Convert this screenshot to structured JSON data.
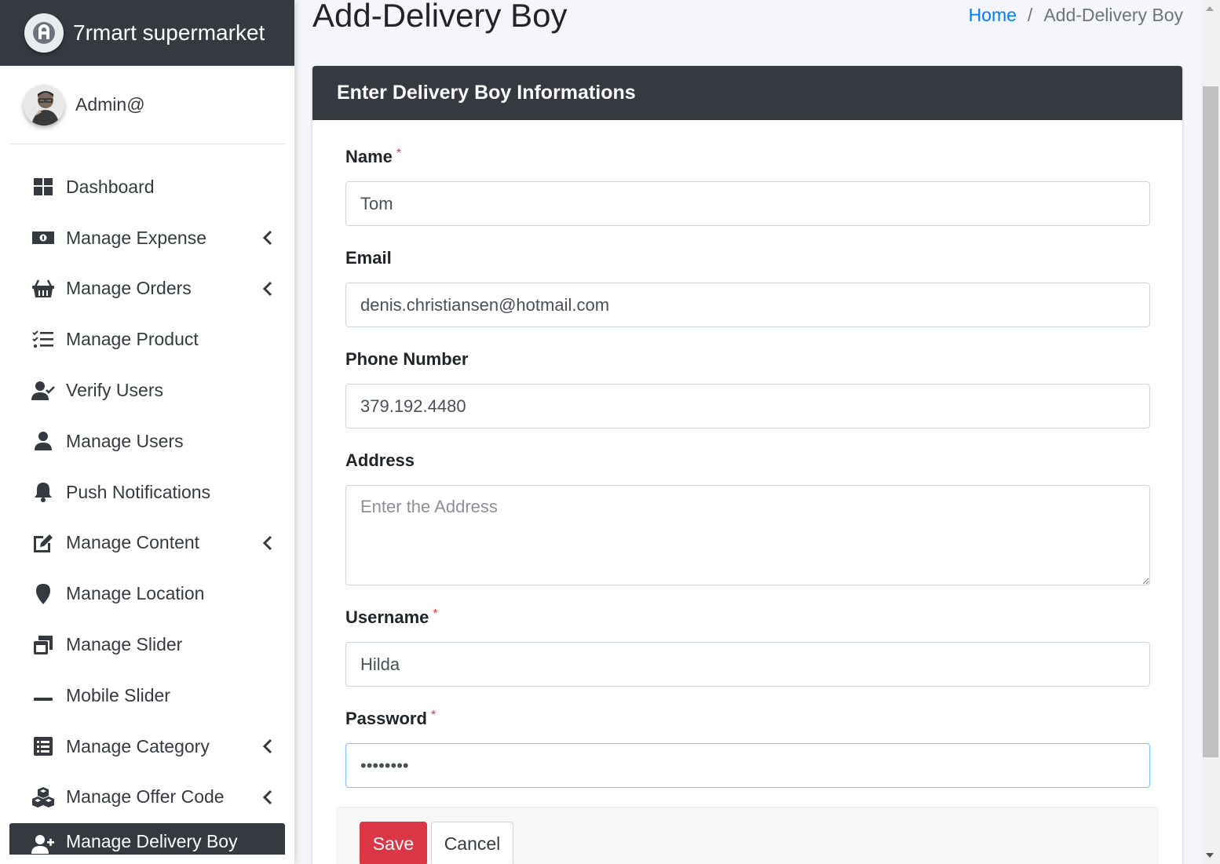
{
  "brand": {
    "name": "7rmart supermarket"
  },
  "user": {
    "name": "Admin@"
  },
  "sidebar": {
    "items": [
      {
        "label": "Dashboard",
        "icon": "dashboard-icon",
        "has_arrow": false
      },
      {
        "label": "Manage Expense",
        "icon": "money-bill-icon",
        "has_arrow": true
      },
      {
        "label": "Manage Orders",
        "icon": "shopping-basket-icon",
        "has_arrow": true
      },
      {
        "label": "Manage Product",
        "icon": "tasks-list-icon",
        "has_arrow": false
      },
      {
        "label": "Verify Users",
        "icon": "user-check-icon",
        "has_arrow": false
      },
      {
        "label": "Manage Users",
        "icon": "user-icon",
        "has_arrow": false
      },
      {
        "label": "Push Notifications",
        "icon": "bell-icon",
        "has_arrow": false
      },
      {
        "label": "Manage Content",
        "icon": "edit-icon",
        "has_arrow": true
      },
      {
        "label": "Manage Location",
        "icon": "map-marker-icon",
        "has_arrow": false
      },
      {
        "label": "Manage Slider",
        "icon": "window-restore-icon",
        "has_arrow": false
      },
      {
        "label": "Mobile Slider",
        "icon": "minus-icon",
        "has_arrow": false
      },
      {
        "label": "Manage Category",
        "icon": "list-alt-icon",
        "has_arrow": true
      },
      {
        "label": "Manage Offer Code",
        "icon": "cubes-icon",
        "has_arrow": true
      },
      {
        "label": "Manage Delivery Boy",
        "icon": "user-plus-icon",
        "has_arrow": false,
        "active": true
      }
    ]
  },
  "header": {
    "title": "Add-Delivery Boy",
    "breadcrumb": {
      "home": "Home",
      "separator": "/",
      "current": "Add-Delivery Boy"
    }
  },
  "form": {
    "title": "Enter Delivery Boy Informations",
    "name": {
      "label": "Name",
      "required": "*",
      "value": "Tom"
    },
    "email": {
      "label": "Email",
      "value": "denis.christiansen@hotmail.com"
    },
    "phone": {
      "label": "Phone Number",
      "value": "379.192.4480"
    },
    "address": {
      "label": "Address",
      "placeholder": "Enter the Address",
      "value": ""
    },
    "username": {
      "label": "Username",
      "required": "*",
      "value": "Hilda"
    },
    "password": {
      "label": "Password",
      "required": "*",
      "value": "••••••••"
    },
    "save_label": "Save",
    "cancel_label": "Cancel"
  },
  "colors": {
    "sidebar_dark": "#343a40",
    "link": "#007bff",
    "danger": "#dc3545",
    "focus_border": "#80bdff"
  }
}
